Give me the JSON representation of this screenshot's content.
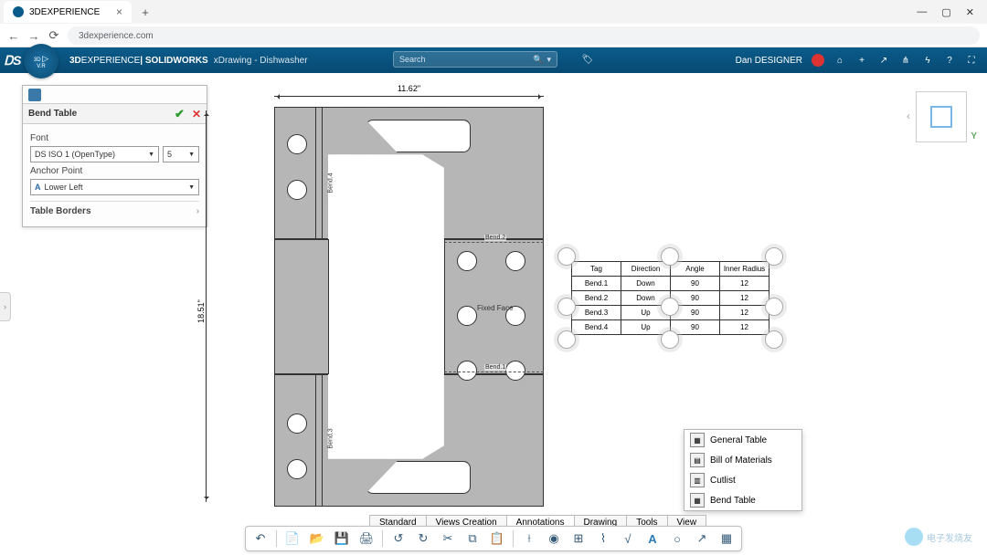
{
  "browser": {
    "tab_title": "3DEXPERIENCE",
    "url": "3dexperience.com",
    "win": {
      "min": "—",
      "max": "▢",
      "close": "✕"
    }
  },
  "app": {
    "brand1": "3D",
    "brand2": "EXPERIENCE",
    "brand3": " | SOLIDWORKS",
    "sub": "xDrawing - Dishwasher",
    "search": "Search",
    "user": "Dan DESIGNER"
  },
  "compass": {
    "l1": "3D",
    "tri": "▷",
    "l2": "V.R"
  },
  "panel": {
    "title": "Bend Table",
    "font_label": "Font",
    "font_family": "DS ISO 1 (OpenType)",
    "font_size": "5",
    "anchor_label": "Anchor Point",
    "anchor_val": "Lower Left",
    "borders_label": "Table Borders"
  },
  "drawing": {
    "dim_w": "11.62\"",
    "dim_h": "18.51\"",
    "bend1": "Bend.1",
    "bend2": "Bend.2",
    "bend3": "Bend.3",
    "bend4": "Bend.4",
    "fixed": "Fixed Face"
  },
  "bend_table": {
    "headers": [
      "Tag",
      "Direction",
      "Angle",
      "Inner Radius"
    ],
    "rows": [
      [
        "Bend.1",
        "Down",
        "90",
        "12"
      ],
      [
        "Bend.2",
        "Down",
        "90",
        "12"
      ],
      [
        "Bend.3",
        "Up",
        "90",
        "12"
      ],
      [
        "Bend.4",
        "Up",
        "90",
        "12"
      ]
    ]
  },
  "insert_menu": {
    "items": [
      "General Table",
      "Bill of Materials",
      "Cutlist",
      "Bend Table"
    ]
  },
  "tool_tabs": [
    "Standard",
    "Views Creation",
    "Annotations",
    "Drawing",
    "Tools",
    "View"
  ],
  "gizmo": {
    "y": "Y"
  },
  "watermark": "电子发烧友"
}
